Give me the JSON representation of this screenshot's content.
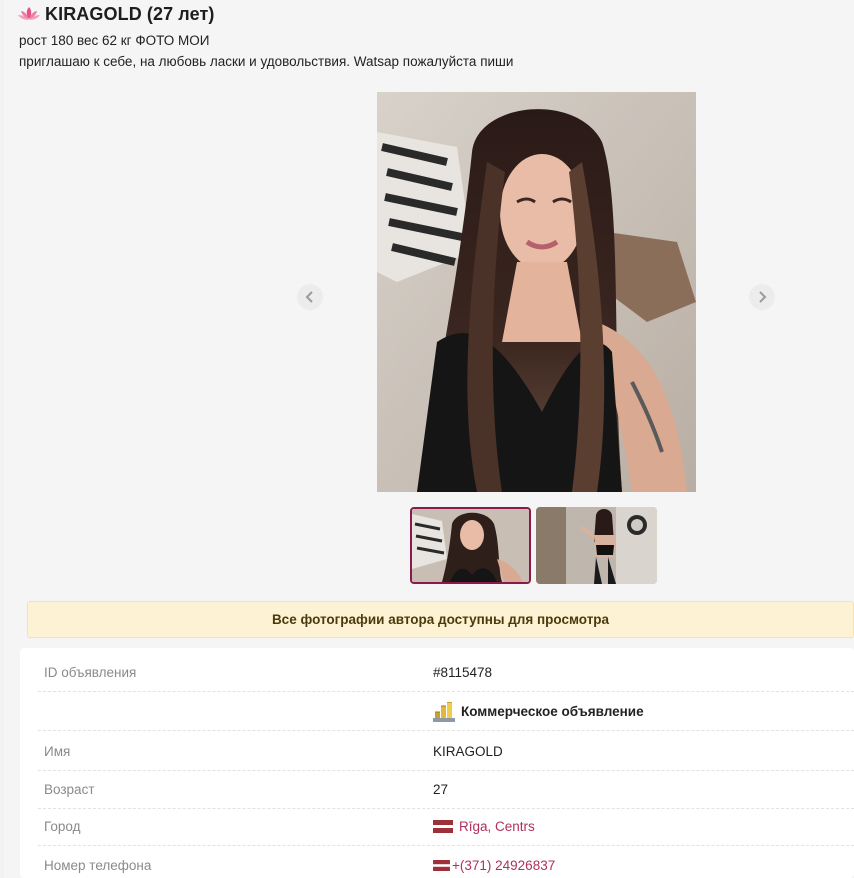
{
  "header": {
    "title": "KIRAGOLD (27 лет)",
    "description_line1": "рост 180 вес 62 кг ФОТО МОИ",
    "description_line2": "приглашаю к себе, на любовь ласки и удовольствия. Watsap пожалуйста пиши"
  },
  "gallery": {
    "thumbnail_count": 2,
    "selected_index": 0
  },
  "notice": {
    "text": "Все фотографии автора доступны для просмотра"
  },
  "details": {
    "id_label": "ID объявления",
    "id_value": "#8115478",
    "commercial_value": "Коммерческое объявление",
    "name_label": "Имя",
    "name_value": "KIRAGOLD",
    "age_label": "Возраст",
    "age_value": "27",
    "city_label": "Город",
    "city_value": "Rīga, Centrs",
    "phone_label": "Номер телефона",
    "phone_value": "+(371) 24926837"
  },
  "colors": {
    "accent": "#b0305e",
    "notice_bg": "#fdf3d4",
    "latvia_red": "#9e3039"
  }
}
